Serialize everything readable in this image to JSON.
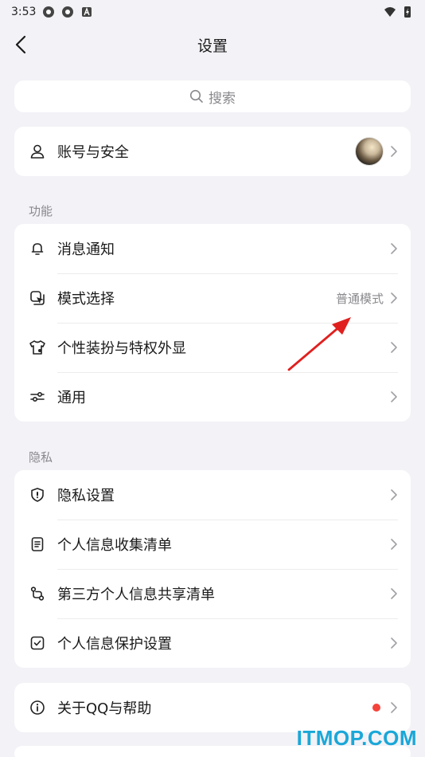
{
  "status_bar": {
    "time": "3:53"
  },
  "header": {
    "title": "设置"
  },
  "search": {
    "placeholder": "搜索"
  },
  "account": {
    "label": "账号与安全"
  },
  "features": {
    "section_title": "功能",
    "items": [
      {
        "label": "消息通知",
        "icon": "bell-icon"
      },
      {
        "label": "模式选择",
        "icon": "mode-icon",
        "value": "普通模式"
      },
      {
        "label": "个性装扮与特权外显",
        "icon": "shirt-icon"
      },
      {
        "label": "通用",
        "icon": "sliders-icon"
      }
    ]
  },
  "privacy": {
    "section_title": "隐私",
    "items": [
      {
        "label": "隐私设置",
        "icon": "shield-icon"
      },
      {
        "label": "个人信息收集清单",
        "icon": "document-icon"
      },
      {
        "label": "第三方个人信息共享清单",
        "icon": "share-icon"
      },
      {
        "label": "个人信息保护设置",
        "icon": "checkbox-icon"
      }
    ]
  },
  "about": {
    "label": "关于QQ与帮助",
    "icon": "info-icon",
    "badge_color": "#f5433b"
  },
  "watermark": "ITMOP.COM",
  "colors": {
    "background": "#f2f2f7",
    "card": "#ffffff",
    "annotation_arrow": "#e0201f",
    "watermark": "#1aa7d8"
  }
}
